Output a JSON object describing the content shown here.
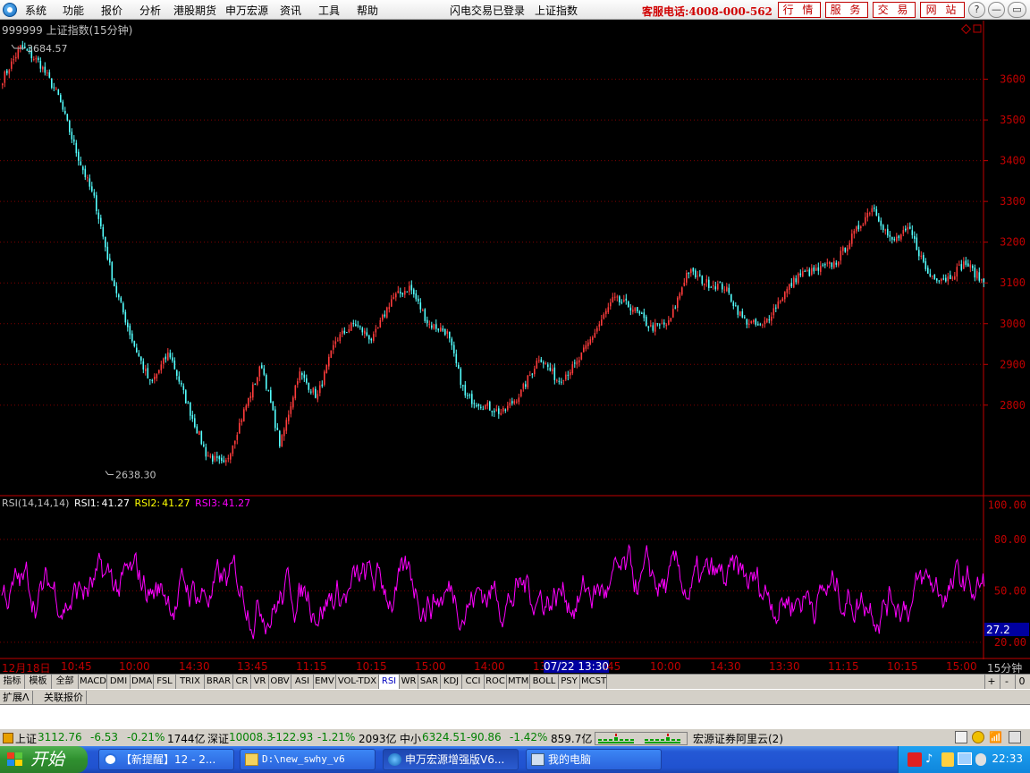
{
  "menu": {
    "items": [
      "系统",
      "功能",
      "报价",
      "分析",
      "港股期货",
      "申万宏源",
      "资讯",
      "工具",
      "帮助"
    ],
    "login_status": "闪电交易已登录",
    "current_security": "上证指数",
    "hotline": "客服电话:4008-000-562",
    "buttons": [
      "行 情",
      "服 务",
      "交 易",
      "网 站"
    ]
  },
  "window_controls": [
    "?",
    "—",
    "▭",
    "✕"
  ],
  "chart": {
    "title": "999999 上证指数(15分钟)",
    "high_label": "3684.57",
    "low_label": "2638.30",
    "period_label": "15分钟"
  },
  "rsi": {
    "name": "RSI(14,14,14)",
    "rsi1_label": "RSI1:",
    "rsi1": "41.27",
    "rsi2_label": "RSI2:",
    "rsi2": "41.27",
    "rsi3_label": "RSI3:",
    "rsi3": "41.27",
    "current_value": "27.2"
  },
  "chart_data": [
    {
      "type": "candlestick",
      "title": "999999 上证指数(15分钟)",
      "ylim": [
        2580,
        3700
      ],
      "y_ticks": [
        2800,
        2900,
        3000,
        3100,
        3200,
        3300,
        3400,
        3500,
        3600
      ],
      "annotations": {
        "high": 3684.57,
        "low": 2638.3
      },
      "close_path_approx": [
        3600,
        3680,
        3640,
        3560,
        3420,
        3300,
        3100,
        2960,
        2850,
        2930,
        2800,
        2680,
        2650,
        2780,
        2900,
        2700,
        2880,
        2820,
        2960,
        3000,
        2960,
        3060,
        3090,
        3000,
        2980,
        2820,
        2800,
        2780,
        2830,
        2920,
        2860,
        2900,
        2980,
        3060,
        3040,
        2990,
        3000,
        3130,
        3100,
        3090,
        3010,
        2990,
        3060,
        3120,
        3130,
        3150,
        3220,
        3290,
        3200,
        3230,
        3120,
        3110,
        3150,
        3100
      ]
    },
    {
      "type": "line",
      "title": "RSI(14,14,14)",
      "ylim": [
        10,
        105
      ],
      "y_ticks": [
        20,
        50,
        80,
        100
      ],
      "series": [
        {
          "name": "RSI3",
          "last_value": 41.27
        }
      ]
    }
  ],
  "time_axis": [
    "12月18日",
    "10:45",
    "10:00",
    "14:30",
    "13:45",
    "11:15",
    "10:15",
    "15:00",
    "14:00",
    "13",
    "07/22 13:30",
    ":45",
    "10:00",
    "14:30",
    "13:30",
    "11:15",
    "10:15",
    "15:00"
  ],
  "indicator_tabs": [
    "指标",
    "模板",
    "全部",
    "MACD",
    "DMI",
    "DMA",
    "FSL",
    "TRIX",
    "BRAR",
    "CR",
    "VR",
    "OBV",
    "ASI",
    "EMV",
    "VOL-TDX",
    "RSI",
    "WR",
    "SAR",
    "KDJ",
    "CCI",
    "ROC",
    "MTM",
    "BOLL",
    "PSY",
    "MCST"
  ],
  "active_indicator": "RSI",
  "zoom_controls": [
    "+",
    "-",
    "0"
  ],
  "ext_tabs": [
    "扩展Λ",
    "关联报价"
  ],
  "status": {
    "sh_name": "上证",
    "sh_value": "3112.76",
    "sh_change": "-6.53",
    "sh_pct": "-0.21%",
    "sh_amount": "1744亿",
    "sz_name": "深证",
    "sz_value": "10008.3",
    "sz_change": "-122.93",
    "sz_pct": "-1.21%",
    "sz_amount": "2093亿",
    "zx_name": "中小",
    "zx_value": "6324.51",
    "zx_change": "-90.86",
    "zx_pct": "-1.42%",
    "zx_amount": "859.7亿",
    "broker": "宏源证券阿里云(2)"
  },
  "taskbar": {
    "start": "开始",
    "tasks": [
      "【新提醒】12 - 2...",
      "D:\\new_swhy_v6",
      "申万宏源增强版V6...",
      "我的电脑"
    ],
    "clock": "22:33"
  },
  "colors": {
    "up": "#ff3c3c",
    "down": "#54ffff",
    "rsi": "#ff00ff",
    "axis": "#c00000",
    "grid": "#800000"
  }
}
